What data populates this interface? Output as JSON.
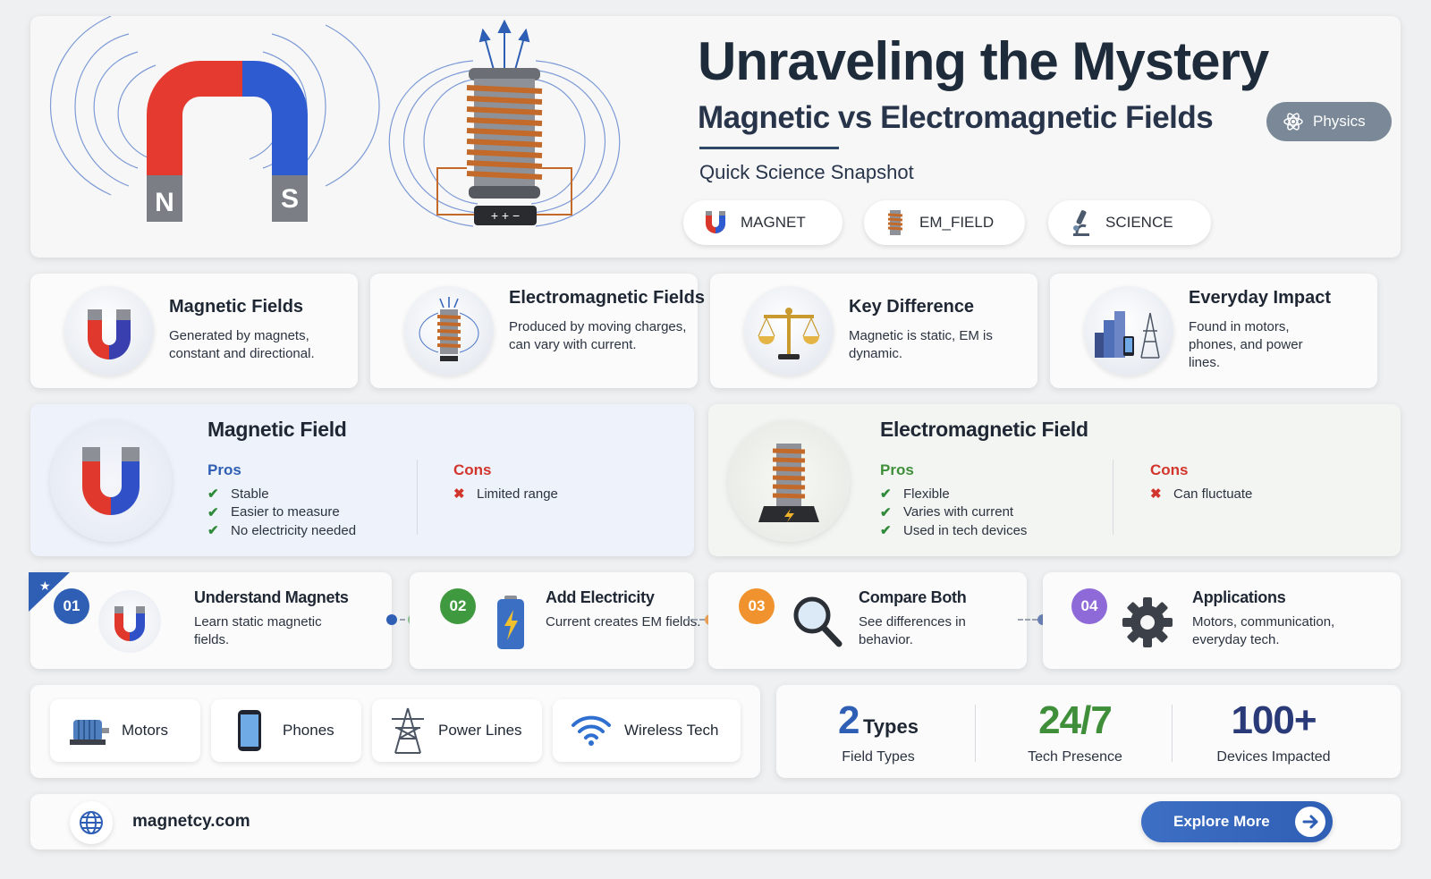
{
  "hero": {
    "title": "Unraveling the Mystery",
    "subtitle": "Magnetic vs Electromagnetic Fields",
    "tagline": "Quick Science Snapshot",
    "category_badge": "Physics",
    "magnet_labels": {
      "north": "N",
      "south": "S"
    },
    "chips": [
      {
        "label": "MAGNET",
        "icon": "magnet-icon"
      },
      {
        "label": "EM_FIELD",
        "icon": "coil-icon"
      },
      {
        "label": "SCIENCE",
        "icon": "microscope-icon"
      }
    ]
  },
  "features": [
    {
      "title": "Magnetic Fields",
      "text": "Generated by magnets, constant and directional.",
      "icon": "magnet-icon"
    },
    {
      "title": "Electromagnetic Fields",
      "text": "Produced by moving charges, can vary with current.",
      "icon": "coil-icon"
    },
    {
      "title": "Key Difference",
      "text": "Magnetic is static, EM is dynamic.",
      "icon": "scale-icon"
    },
    {
      "title": "Everyday Impact",
      "text": "Found in motors, phones, and power lines.",
      "icon": "city-icon"
    }
  ],
  "comparison": {
    "magnetic": {
      "title": "Magnetic Field",
      "pros_label": "Pros",
      "pros": [
        "Stable",
        "Easier to measure",
        "No electricity needed"
      ],
      "cons_label": "Cons",
      "cons": [
        "Limited range"
      ]
    },
    "electromagnetic": {
      "title": "Electromagnetic Field",
      "pros_label": "Pros",
      "pros": [
        "Flexible",
        "Varies with current",
        "Used in tech devices"
      ],
      "cons_label": "Cons",
      "cons": [
        "Can fluctuate"
      ]
    }
  },
  "steps": [
    {
      "num": "01",
      "title": "Understand Magnets",
      "text": "Learn static magnetic fields.",
      "color": "#2f5fb5",
      "icon": "magnet-icon"
    },
    {
      "num": "02",
      "title": "Add Electricity",
      "text": "Current creates EM fields.",
      "color": "#3f9a3f",
      "icon": "battery-icon"
    },
    {
      "num": "03",
      "title": "Compare Both",
      "text": "See differences in behavior.",
      "color": "#f0922e",
      "icon": "magnifier-icon"
    },
    {
      "num": "04",
      "title": "Applications",
      "text": "Motors, communication, everyday tech.",
      "color": "#8e6ad8",
      "icon": "gear-icon"
    }
  ],
  "applications": [
    {
      "label": "Motors",
      "icon": "motor-icon"
    },
    {
      "label": "Phones",
      "icon": "phone-icon"
    },
    {
      "label": "Power Lines",
      "icon": "power-tower-icon"
    },
    {
      "label": "Wireless Tech",
      "icon": "wifi-icon"
    }
  ],
  "stats": [
    {
      "value": "2",
      "unit": "Types",
      "caption": "Field Types",
      "color": "#2f5fb5"
    },
    {
      "value": "24/7",
      "unit": "",
      "caption": "Tech Presence",
      "color": "#3f8f3a"
    },
    {
      "value": "100+",
      "unit": "",
      "caption": "Devices Impacted",
      "color": "#2a3a78"
    }
  ],
  "footer": {
    "site": "magnetcy.com",
    "cta": "Explore More"
  }
}
